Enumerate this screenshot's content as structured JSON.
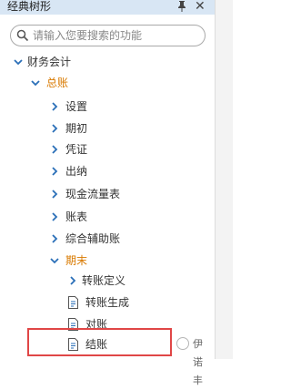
{
  "panel": {
    "title": "经典树形"
  },
  "search": {
    "placeholder": "请输入您要搜索的功能"
  },
  "tree": {
    "finance": "财务会计",
    "ledger": "总账",
    "items": [
      "设置",
      "期初",
      "凭证",
      "出纳",
      "现金流量表",
      "账表",
      "综合辅助账"
    ],
    "period_end": "期末",
    "period_items": [
      "转账定义",
      "转账生成",
      "对账",
      "结账"
    ]
  },
  "watermark": {
    "text": "伊诺丰"
  },
  "colors": {
    "accent": "#d97a00",
    "highlight": "#e04646"
  }
}
